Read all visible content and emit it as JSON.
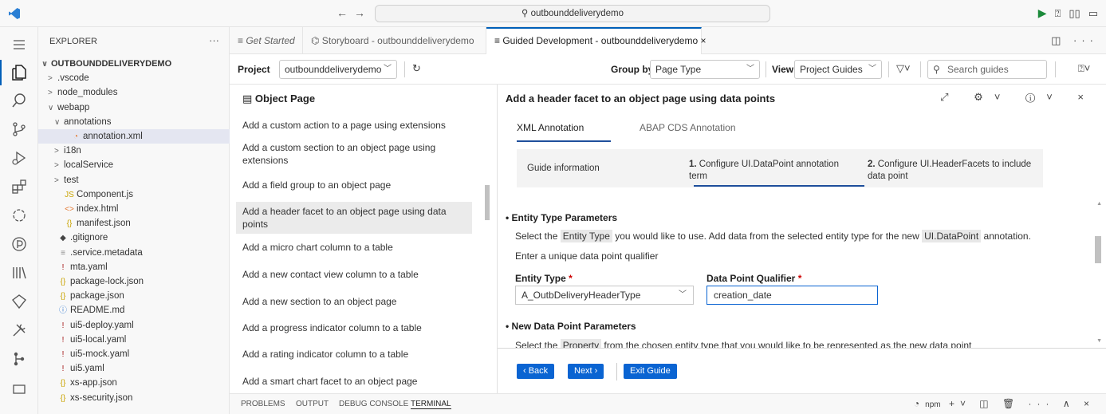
{
  "titlebar": {
    "search_text": "outbounddeliverydemo",
    "app_icon": "vscode-logo-icon",
    "accent_run": "#1b8a3a"
  },
  "explorer": {
    "header": "EXPLORER",
    "more": "···",
    "items": [
      {
        "label": "OUTBOUNDDELIVERYDEMO",
        "indent": 0,
        "chev": "∨",
        "icon": "",
        "root": true
      },
      {
        "label": ".vscode",
        "indent": 1,
        "chev": ">",
        "icon": ""
      },
      {
        "label": "node_modules",
        "indent": 1,
        "chev": ">",
        "icon": ""
      },
      {
        "label": "webapp",
        "indent": 1,
        "chev": "∨",
        "icon": ""
      },
      {
        "label": "annotations",
        "indent": 2,
        "chev": "∨",
        "icon": ""
      },
      {
        "label": "annotation.xml",
        "indent": 3,
        "chev": "",
        "icon": "rss",
        "selected": true
      },
      {
        "label": "i18n",
        "indent": 2,
        "chev": ">",
        "icon": ""
      },
      {
        "label": "localService",
        "indent": 2,
        "chev": ">",
        "icon": ""
      },
      {
        "label": "test",
        "indent": 2,
        "chev": ">",
        "icon": ""
      },
      {
        "label": "Component.js",
        "indent": 2,
        "chev": "",
        "icon": "JS"
      },
      {
        "label": "index.html",
        "indent": 2,
        "chev": "",
        "icon": "<>"
      },
      {
        "label": "manifest.json",
        "indent": 2,
        "chev": "",
        "icon": "{}"
      },
      {
        "label": ".gitignore",
        "indent": 1,
        "chev": "",
        "icon": "◆"
      },
      {
        "label": ".service.metadata",
        "indent": 1,
        "chev": "",
        "icon": "≡"
      },
      {
        "label": "mta.yaml",
        "indent": 1,
        "chev": "",
        "icon": "!"
      },
      {
        "label": "package-lock.json",
        "indent": 1,
        "chev": "",
        "icon": "{}"
      },
      {
        "label": "package.json",
        "indent": 1,
        "chev": "",
        "icon": "{}"
      },
      {
        "label": "README.md",
        "indent": 1,
        "chev": "",
        "icon": "ⓘ"
      },
      {
        "label": "ui5-deploy.yaml",
        "indent": 1,
        "chev": "",
        "icon": "!"
      },
      {
        "label": "ui5-local.yaml",
        "indent": 1,
        "chev": "",
        "icon": "!"
      },
      {
        "label": "ui5-mock.yaml",
        "indent": 1,
        "chev": "",
        "icon": "!"
      },
      {
        "label": "ui5.yaml",
        "indent": 1,
        "chev": "",
        "icon": "!"
      },
      {
        "label": "xs-app.json",
        "indent": 1,
        "chev": "",
        "icon": "{}"
      },
      {
        "label": "xs-security.json",
        "indent": 1,
        "chev": "",
        "icon": "{}"
      }
    ]
  },
  "tabs": [
    {
      "label": "≡ Get Started",
      "italic": true,
      "active": false
    },
    {
      "label": "⌬ Storyboard - outbounddeliverydemo",
      "italic": false,
      "active": false
    },
    {
      "label": "≡ Guided Development - outbounddeliverydemo ×",
      "italic": false,
      "active": true
    }
  ],
  "toolbar": {
    "project_label": "Project",
    "project_value": "outbounddeliverydemo",
    "group_label": "Group by",
    "group_value": "Page Type",
    "view_label": "View",
    "view_value": "Project Guides",
    "search_placeholder": "Search guides"
  },
  "guide_list": {
    "title": "Object Page",
    "items": [
      {
        "label": "Add a custom action to a page using extensions"
      },
      {
        "label": "Add a custom section to an object page using extensions"
      },
      {
        "label": "Add a field group to an object page"
      },
      {
        "label": "Add a header facet to an object page using data points",
        "selected": true
      },
      {
        "label": "Add a micro chart column to a table"
      },
      {
        "label": "Add a new contact view column to a table"
      },
      {
        "label": "Add a new section to an object page"
      },
      {
        "label": "Add a progress indicator column to a table"
      },
      {
        "label": "Add a rating indicator column to a table"
      },
      {
        "label": "Add a smart chart facet to an object page"
      }
    ]
  },
  "detail": {
    "title": "Add a header facet to an object page using data points",
    "annotation_tabs": [
      "XML Annotation",
      "ABAP CDS Annotation"
    ],
    "steps": {
      "info": "Guide information",
      "step1_num": "1.",
      "step1_line1": "Configure UI.DataPoint annotation",
      "step1_line2": "term",
      "step2_num": "2.",
      "step2_line1": "Configure UI.HeaderFacets to include",
      "step2_line2": "data point"
    },
    "entity_section": {
      "heading": "Entity Type Parameters",
      "p1_pre": "Select the",
      "p1_chip1": "Entity Type",
      "p1_mid": "you would like to use. Add data from the selected entity type for the new",
      "p1_chip2": "UI.DataPoint",
      "p1_post": "annotation.",
      "p2": "Enter a unique data point qualifier",
      "entity_label": "Entity Type",
      "entity_value": "A_OutbDeliveryHeaderType",
      "qualifier_label": "Data Point Qualifier",
      "qualifier_value": "creation_date",
      "required_mark": "*"
    },
    "datapoint_section": {
      "heading": "New Data Point Parameters",
      "p1_pre": "Select the",
      "p1_chip": "Property",
      "p1_post": "from the chosen entity type that you would like to be represented as the new data point"
    },
    "buttons": {
      "back": "‹ Back",
      "next": "Next ›",
      "exit": "Exit Guide"
    }
  },
  "panel": {
    "tabs": [
      "PROBLEMS",
      "OUTPUT",
      "DEBUG CONSOLE",
      "TERMINAL"
    ],
    "active_tab": "TERMINAL",
    "terminal_name": "npm"
  },
  "colors": {
    "accent": "#005fb8",
    "button": "#0a64d2",
    "selection": "#e4e6f1"
  }
}
